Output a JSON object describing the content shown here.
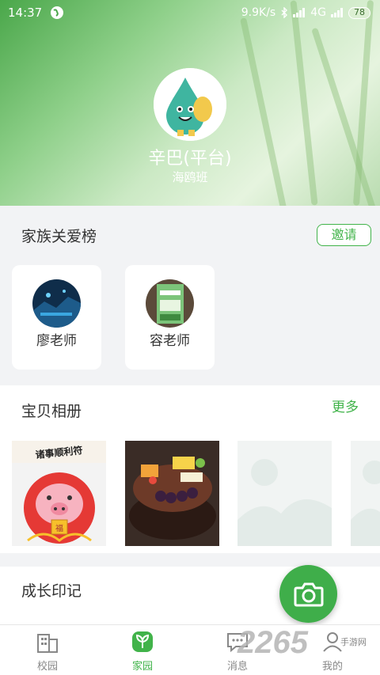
{
  "status_bar": {
    "time": "14:37",
    "network_speed": "9.9K/s",
    "signal_label": "4G",
    "battery": "78"
  },
  "profile": {
    "name": "辛巴(平台)",
    "class_name": "海鸥班"
  },
  "family_section": {
    "title": "家族关爱榜",
    "invite_label": "邀请",
    "members": [
      {
        "name": "廖老师"
      },
      {
        "name": "容老师"
      }
    ]
  },
  "album_section": {
    "title": "宝贝相册",
    "more_label": "更多",
    "photo1_caption": "诸事顺利符",
    "photo1_badge": "福"
  },
  "growth_section": {
    "title": "成长印记"
  },
  "tabbar": {
    "tabs": [
      {
        "label": "校园",
        "icon": "building-icon"
      },
      {
        "label": "家园",
        "icon": "sprout-icon"
      },
      {
        "label": "消息",
        "icon": "chat-icon"
      },
      {
        "label": "我的",
        "icon": "person-icon"
      }
    ],
    "active_index": 1
  },
  "watermark": {
    "brand": "2265",
    "sub": "手游网"
  },
  "colors": {
    "accent": "#41b34a",
    "background": "#f2f3f5"
  }
}
